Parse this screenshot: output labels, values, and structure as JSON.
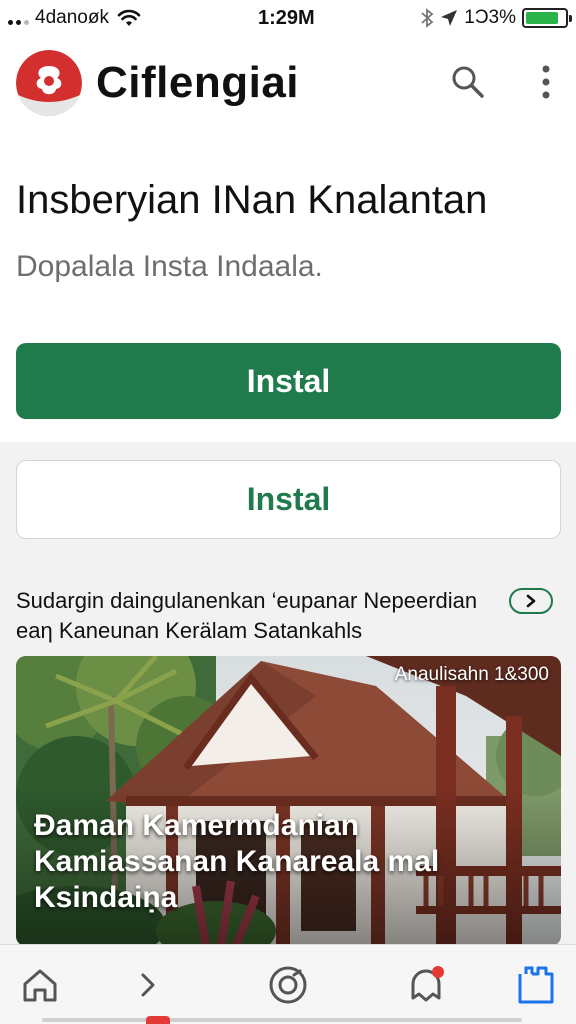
{
  "status_bar": {
    "carrier": "4danoøk",
    "time": "1:29M",
    "battery": "1Ͻ3%",
    "battery_level": 0.85,
    "icons": [
      "signal-icon",
      "wifi-icon",
      "bluetooth-icon",
      "location-arrow-icon",
      "battery-icon"
    ]
  },
  "header": {
    "app_title": "Ciflengiai",
    "logo_icon": "app-logo-icon",
    "actions": [
      "search-icon",
      "more-vertical-icon"
    ]
  },
  "main": {
    "title": "Insberyian INan Knalantan",
    "subtitle": "Dopalala  Insta Indaala.",
    "primary_button": "Instal",
    "secondary_button": "Instal"
  },
  "section": {
    "line1": "Sudargin daingulanenkan ‘eupanar Nepeerdian",
    "line2": "eaη Kaneunan Kerälam Satankahls",
    "arrow_icon": "chevron-right-icon"
  },
  "card": {
    "badge": "Anaulisahn 1&300",
    "caption_line1": "Đaman  Kamermdanian",
    "caption_line2": "Kamiassanan Kanareala mal",
    "caption_line3": "Ksindaiṇa"
  },
  "bottom_nav": {
    "items": [
      "home-icon",
      "chevron-right-icon",
      "camera-icon",
      "notifications-icon",
      "library-icon"
    ],
    "notification_badge": true
  },
  "colors": {
    "accent_green": "#1f7a4c",
    "logo_red": "#d32f2f",
    "badge_red": "#e53935",
    "active_blue": "#1a73e8"
  }
}
